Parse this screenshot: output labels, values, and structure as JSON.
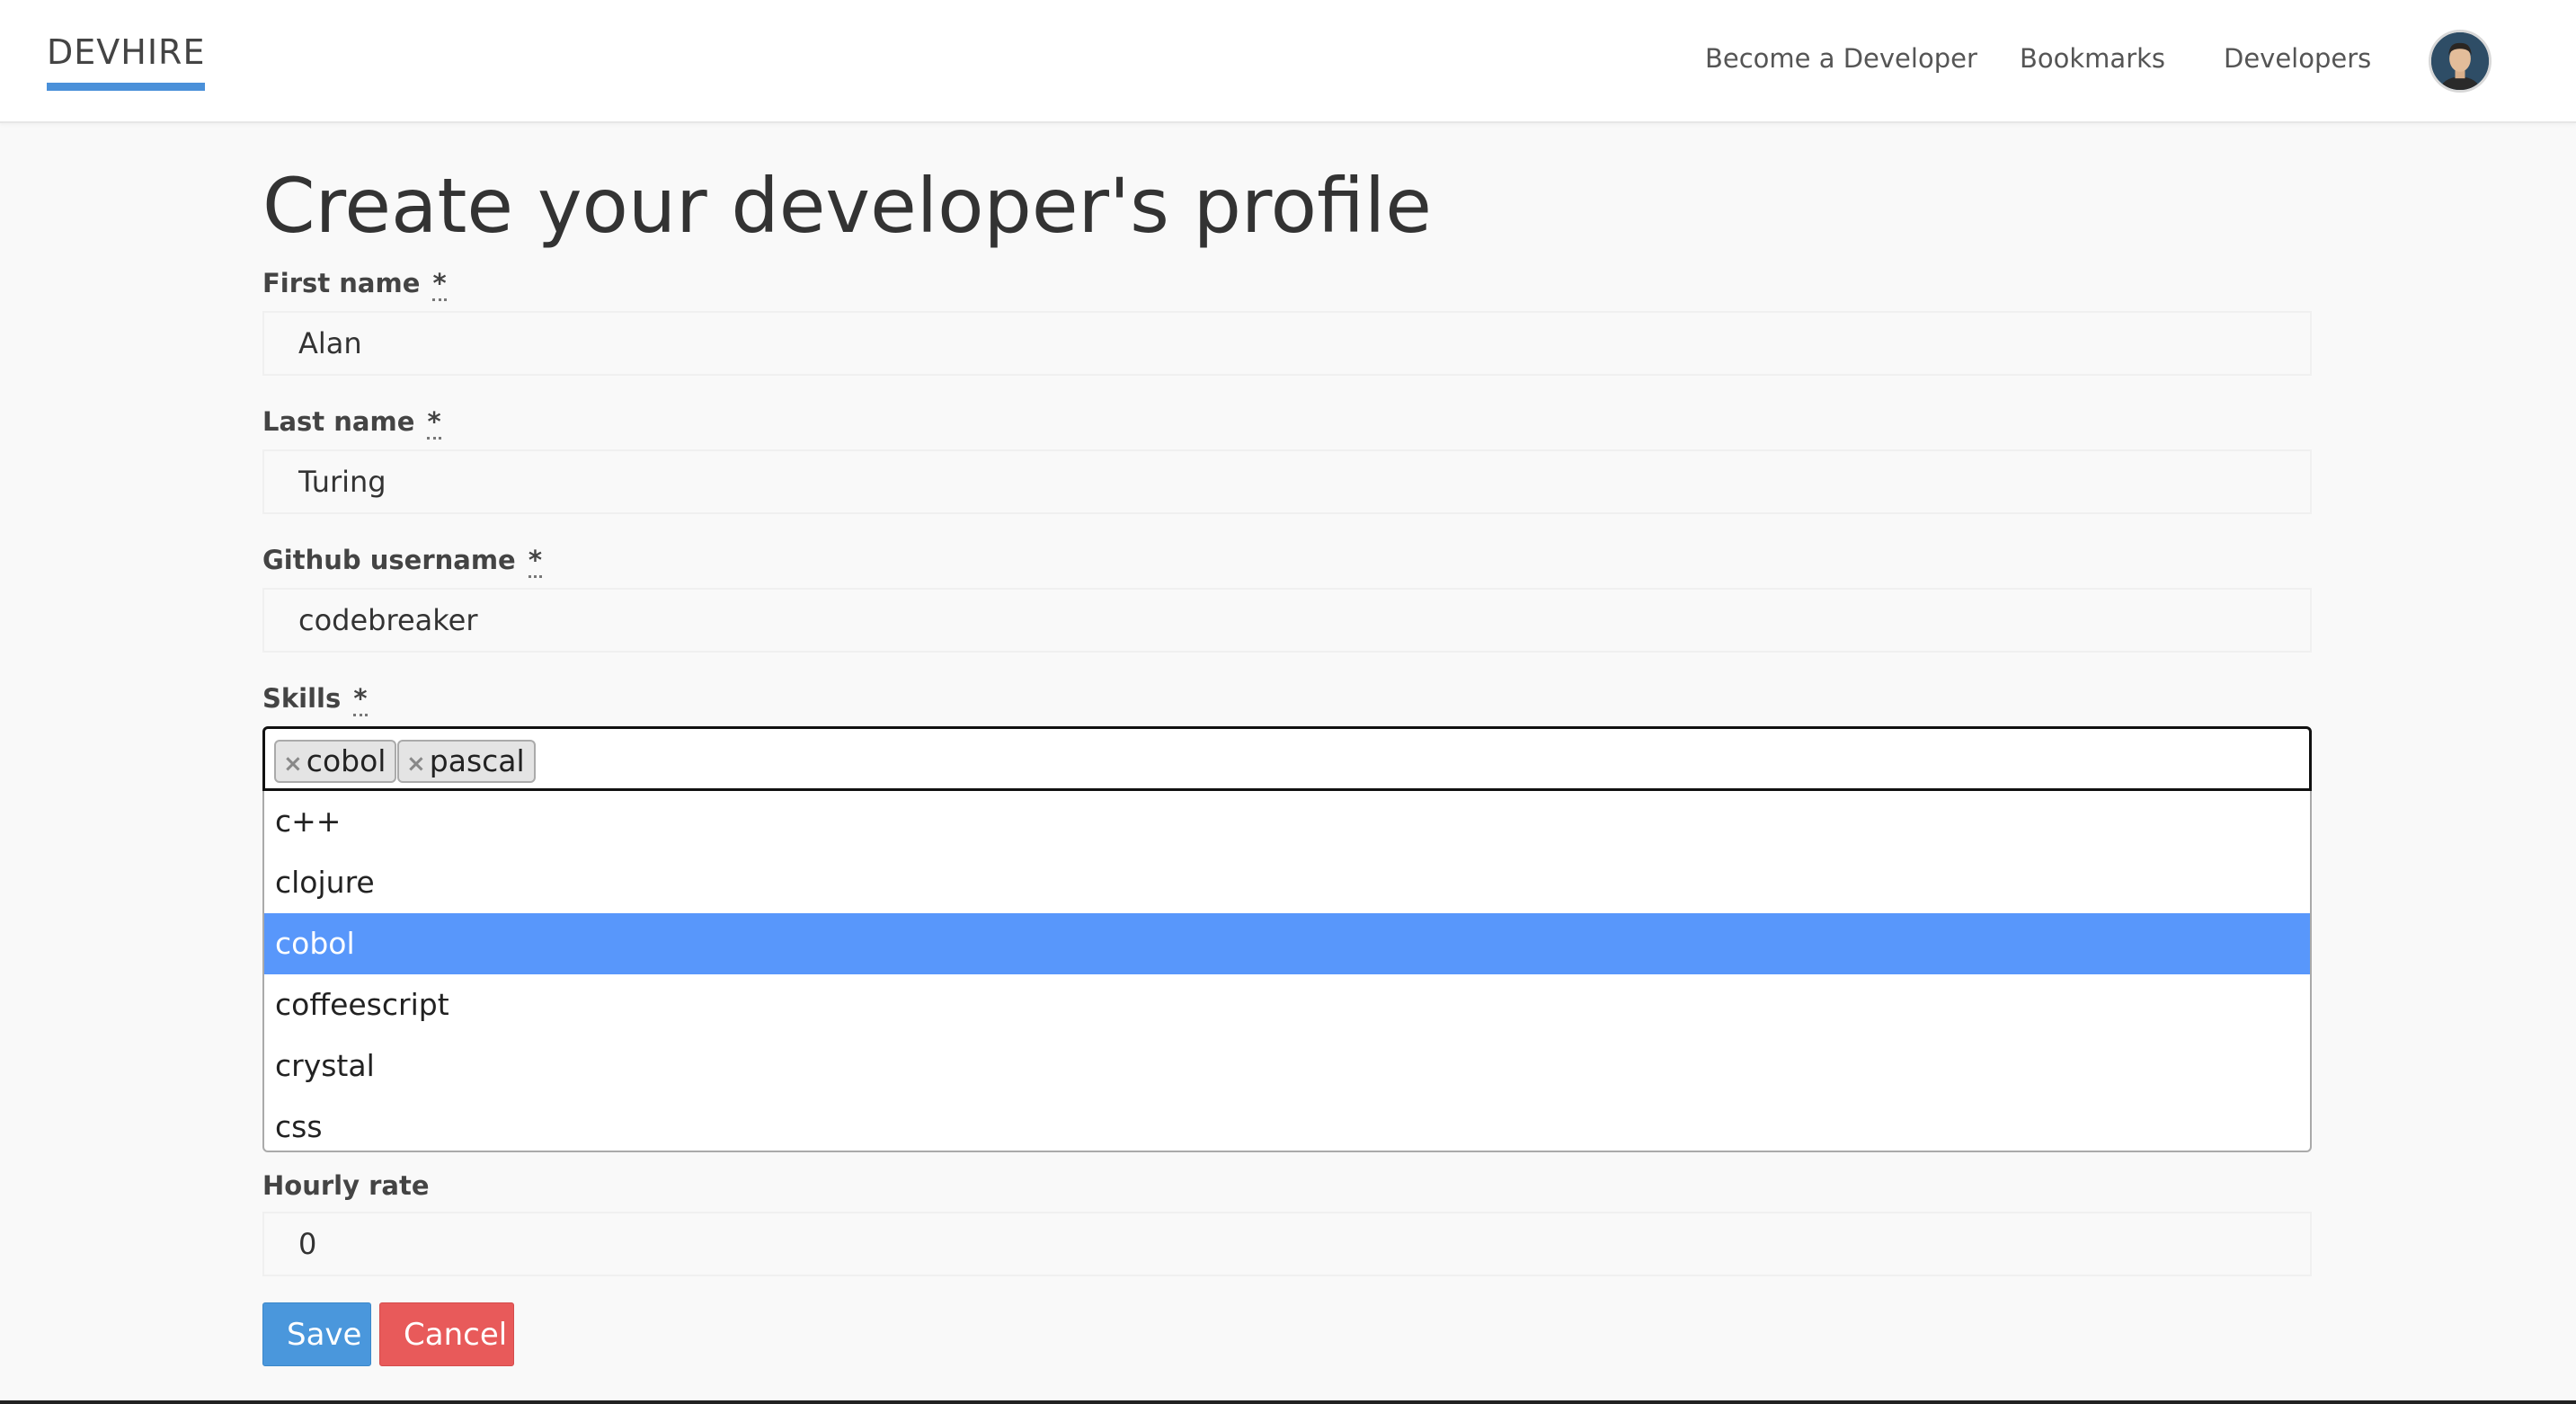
{
  "navbar": {
    "brand": "DEVHIRE",
    "links": [
      "Become a Developer",
      "Bookmarks",
      "Developers"
    ],
    "avatar_icon": "user-avatar",
    "accent_color": "#4a90d9"
  },
  "page": {
    "title": "Create your developer's profile"
  },
  "form": {
    "required_marker": "*",
    "first_name": {
      "label": "First name",
      "value": "Alan"
    },
    "last_name": {
      "label": "Last name",
      "value": "Turing"
    },
    "github": {
      "label": "Github username",
      "value": "codebreaker"
    },
    "skills": {
      "label": "Skills",
      "selected": [
        "cobol",
        "pascal"
      ],
      "remove_glyph": "×",
      "options": [
        "c++",
        "clojure",
        "cobol",
        "coffeescript",
        "crystal",
        "css"
      ],
      "highlighted": "cobol",
      "highlight_color": "#5897fb"
    },
    "hourly_rate": {
      "label": "Hourly rate",
      "value": "0"
    },
    "save_label": "Save",
    "cancel_label": "Cancel"
  }
}
